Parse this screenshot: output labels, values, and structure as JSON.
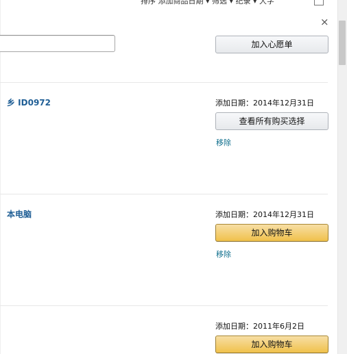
{
  "sort_bar": {
    "text": "排序  添加商品日期   ▾     筛选   ▾      纪录   ▾      大字"
  },
  "close_symbol": "×",
  "note_input": {
    "value": "",
    "placeholder": ""
  },
  "add_to_wishlist_label": "加入心愿单",
  "items": [
    {
      "title": "乡 ID0972",
      "date_added": "添加日期：2014年12月31日",
      "button_label": "查看所有购买选择",
      "button_style": "gray",
      "remove_label": "移除"
    },
    {
      "title": "本电脑",
      "date_added": "添加日期：2014年12月31日",
      "button_label": "加入购物车",
      "button_style": "yellow",
      "remove_label": "移除"
    },
    {
      "title": "",
      "date_added": "添加日期：2011年6月2日",
      "button_label": "加入购物车",
      "button_style": "yellow",
      "remove_label": ""
    }
  ],
  "colors": {
    "link": "#1f5e95",
    "remove_link": "#0e6e8c",
    "primary_button": "#f0c14b",
    "secondary_button": "#e7e9ec"
  }
}
